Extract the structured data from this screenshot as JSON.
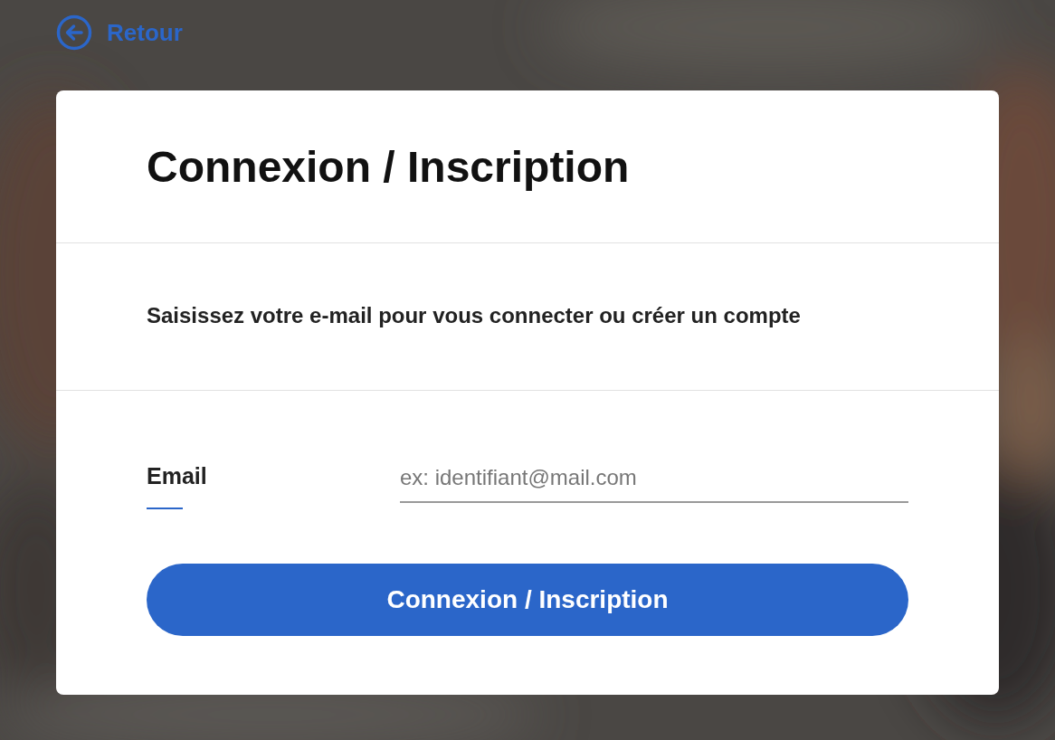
{
  "back_link": {
    "label": "Retour"
  },
  "card": {
    "title": "Connexion / Inscription",
    "subtitle": "Saisissez votre e-mail pour vous connecter ou créer un compte",
    "email_field": {
      "label": "Email",
      "placeholder": "ex: identifiant@mail.com"
    },
    "submit_button": {
      "label": "Connexion / Inscription"
    }
  }
}
